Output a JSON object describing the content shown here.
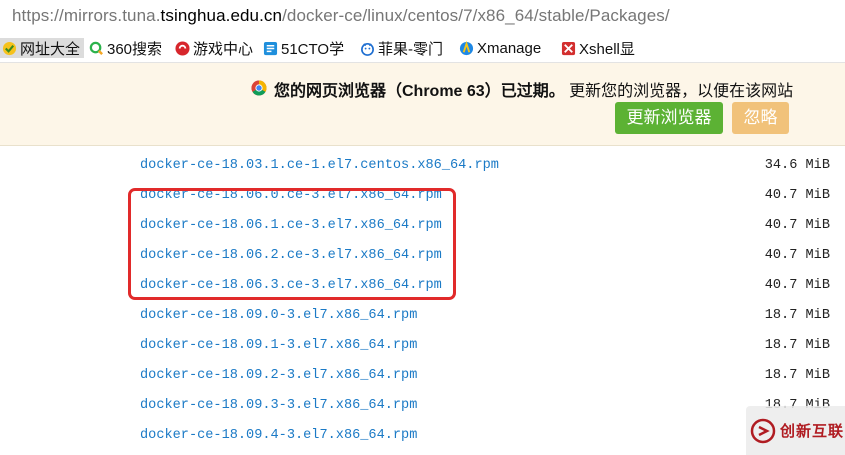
{
  "address_bar": {
    "url_prefix": "https://mirrors.tuna.",
    "url_domain": "tsinghua.edu.cn",
    "url_path": "/docker-ce/linux/centos/7/x86_64/stable/Packages/"
  },
  "bookmarks": [
    {
      "label": "网址大全",
      "icon": "url-navigator-icon"
    },
    {
      "label": "360搜索",
      "icon": "360-search-icon"
    },
    {
      "label": "游戏中心",
      "icon": "game-center-icon"
    },
    {
      "label": "51CTO学",
      "icon": "51cto-icon"
    },
    {
      "label": "菲果-零门",
      "icon": "feiguo-icon"
    },
    {
      "label": "Xmanage",
      "icon": "xmanager-icon"
    },
    {
      "label": "Xshell显",
      "icon": "xshell-icon"
    }
  ],
  "infobar": {
    "message_bold": "您的网页浏览器（Chrome 63）已过期。",
    "message_rest": "更新您的浏览器，以便在该网站",
    "update_label": "更新浏览器",
    "ignore_label": "忽略"
  },
  "files": [
    {
      "name": "docker-ce-18.03.1.ce-1.el7.centos.x86_64.rpm",
      "size": "34.6 MiB"
    },
    {
      "name": "docker-ce-18.06.0.ce-3.el7.x86_64.rpm",
      "size": "40.7 MiB"
    },
    {
      "name": "docker-ce-18.06.1.ce-3.el7.x86_64.rpm",
      "size": "40.7 MiB"
    },
    {
      "name": "docker-ce-18.06.2.ce-3.el7.x86_64.rpm",
      "size": "40.7 MiB"
    },
    {
      "name": "docker-ce-18.06.3.ce-3.el7.x86_64.rpm",
      "size": "40.7 MiB"
    },
    {
      "name": "docker-ce-18.09.0-3.el7.x86_64.rpm",
      "size": "18.7 MiB"
    },
    {
      "name": "docker-ce-18.09.1-3.el7.x86_64.rpm",
      "size": "18.7 MiB"
    },
    {
      "name": "docker-ce-18.09.2-3.el7.x86_64.rpm",
      "size": "18.7 MiB"
    },
    {
      "name": "docker-ce-18.09.3-3.el7.x86_64.rpm",
      "size": "18.7 MiB"
    },
    {
      "name": "docker-ce-18.09.4-3.el7.x86_64.rpm",
      "size": ""
    }
  ],
  "watermark": {
    "text": "创新互联"
  },
  "colors": {
    "link": "#1b7ac6",
    "highlight": "#e12a2a",
    "update_button": "#5cb234",
    "ignore_button": "#f1c27a",
    "infobar_bg": "#fdf6e8"
  }
}
